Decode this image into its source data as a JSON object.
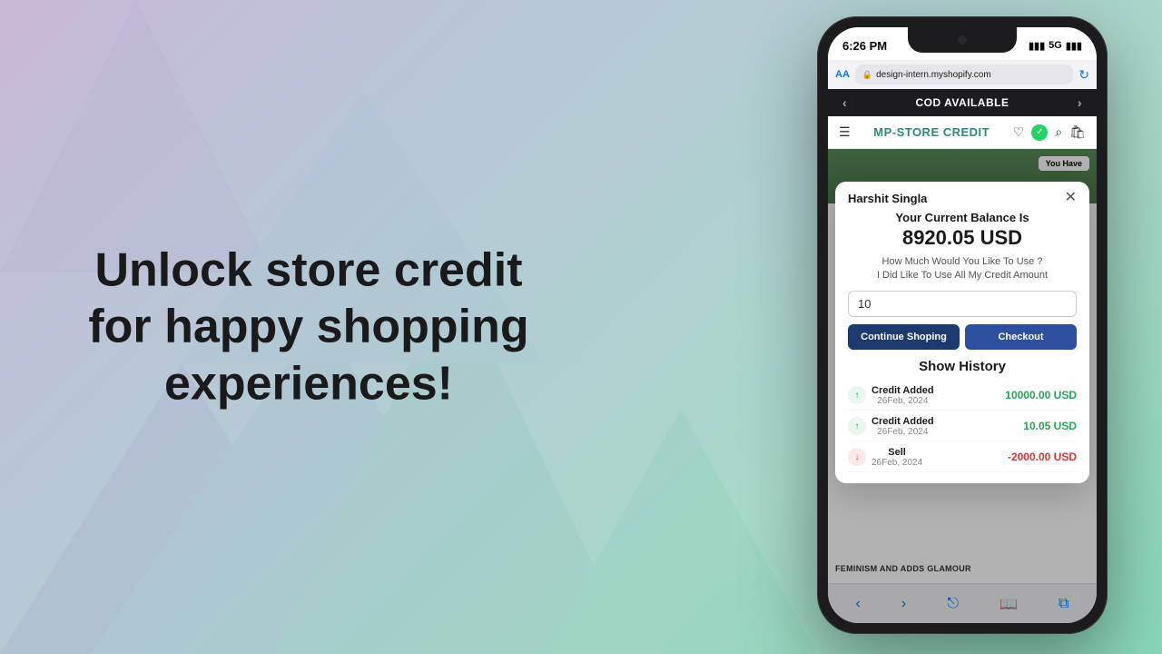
{
  "background": {
    "gradient_start": "#c9b8d8",
    "gradient_end": "#88d8b8"
  },
  "hero": {
    "text": "Unlock store credit for happy shopping experiences!"
  },
  "phone": {
    "status_bar": {
      "time": "6:26 PM",
      "signal": "5G"
    },
    "browser": {
      "aa_label": "AA",
      "url": "design-intern.myshopify.com"
    },
    "cod_banner": {
      "text": "COD AVAILABLE",
      "left_arrow": "‹",
      "right_arrow": "›"
    },
    "store_header": {
      "store_name": "MP-STORE CREDIT"
    },
    "you_have": "You Have",
    "modal": {
      "user_name": "Harshit Singla",
      "balance_label": "Your Current Balance Is",
      "balance_amount": "8920.05 USD",
      "question_line1": "How Much Would You Like To Use ?",
      "question_line2": "I Did Like To Use All My Credit Amount",
      "input_value": "10",
      "btn_continue": "Continue Shoping",
      "btn_checkout": "Checkout",
      "history_title": "Show History",
      "history_items": [
        {
          "type": "credit",
          "label": "Credit Added",
          "date": "26Feb, 2024",
          "amount": "10000.00 USD",
          "color": "green"
        },
        {
          "type": "credit",
          "label": "Credit Added",
          "date": "26Feb, 2024",
          "amount": "10.05 USD",
          "color": "green"
        },
        {
          "type": "debit",
          "label": "Sell",
          "date": "26Feb, 2024",
          "amount": "-2000.00 USD",
          "color": "red"
        }
      ]
    },
    "product_bottom_text": "FEMINISM AND ADDS GLAMOUR"
  }
}
